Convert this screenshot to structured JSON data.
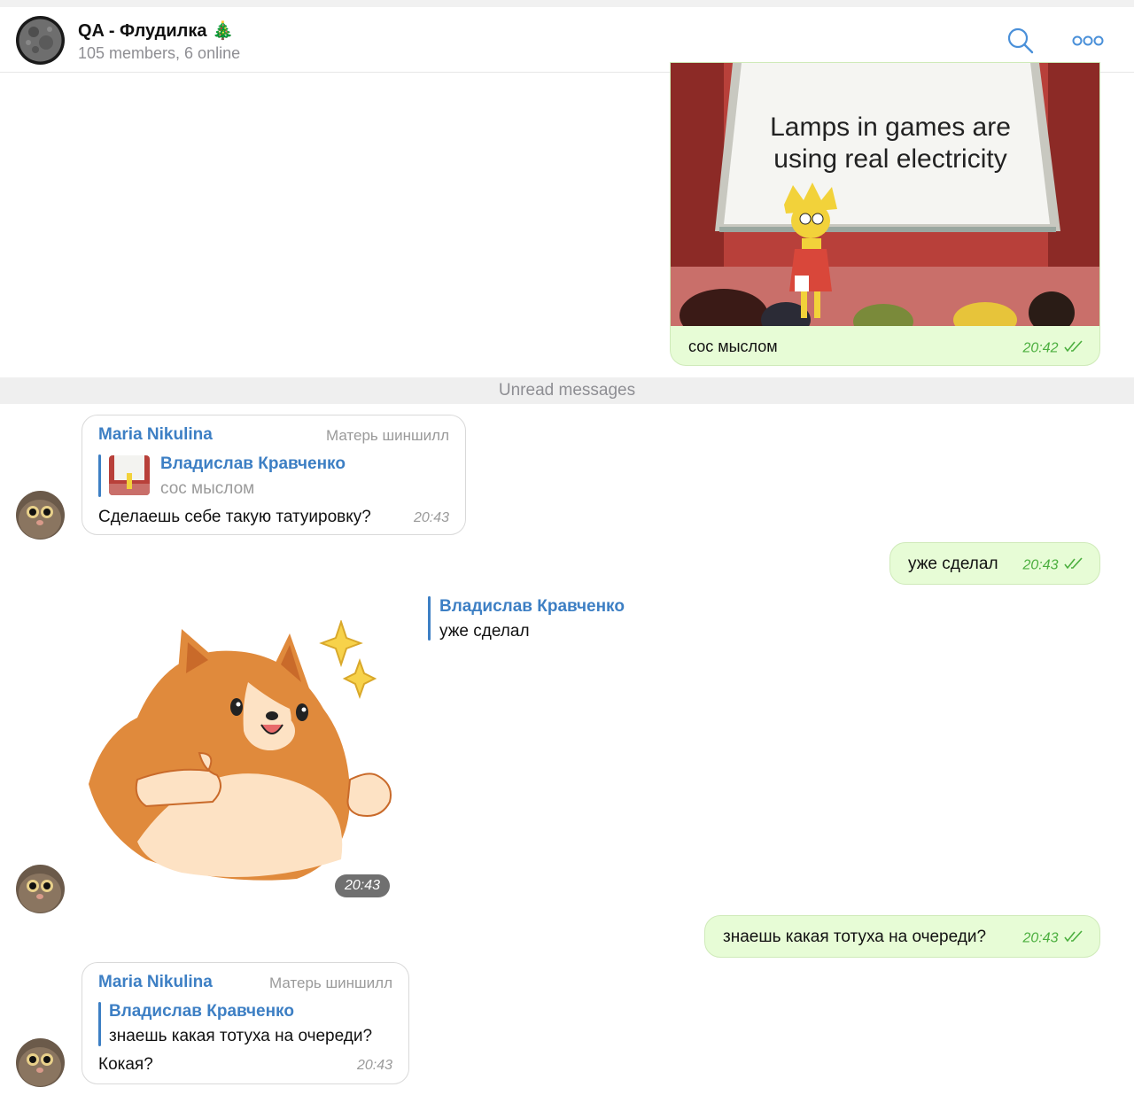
{
  "header": {
    "title": "QA - Флудилка",
    "title_emoji": "🎄",
    "subtitle": "105 members, 6 online"
  },
  "meme": {
    "text_line1": "Lamps in games are",
    "text_line2": "using real electricity"
  },
  "messages": {
    "m1": {
      "caption": "сос мыслом",
      "time": "20:42"
    },
    "unread_label": "Unread messages",
    "m2": {
      "sender": "Maria Nikulina",
      "role": "Матерь шиншилл",
      "reply_name": "Владислав Кравченко",
      "reply_text": "сос мыслом",
      "text": "Сделаешь себе такую татуировку?",
      "time": "20:43"
    },
    "m3": {
      "text": "уже сделал",
      "time": "20:43"
    },
    "m4": {
      "reply_name": "Владислав Кравченко",
      "reply_text": "уже сделал",
      "time": "20:43"
    },
    "m5": {
      "text": "знаешь какая тотуха на очереди?",
      "time": "20:43"
    },
    "m6": {
      "sender": "Maria Nikulina",
      "role": "Матерь шиншилл",
      "reply_name": "Владислав Кравченко",
      "reply_text": "знаешь какая тотуха на очереди?",
      "text": "Кокая?",
      "time": "20:43"
    }
  },
  "colors": {
    "accent": "#3d7fc4",
    "out_bubble": "#e7fcd6",
    "out_time": "#4caf3f"
  },
  "icons": {
    "search": "search-icon",
    "more": "more-icon",
    "read_checks": "double-check-icon"
  }
}
